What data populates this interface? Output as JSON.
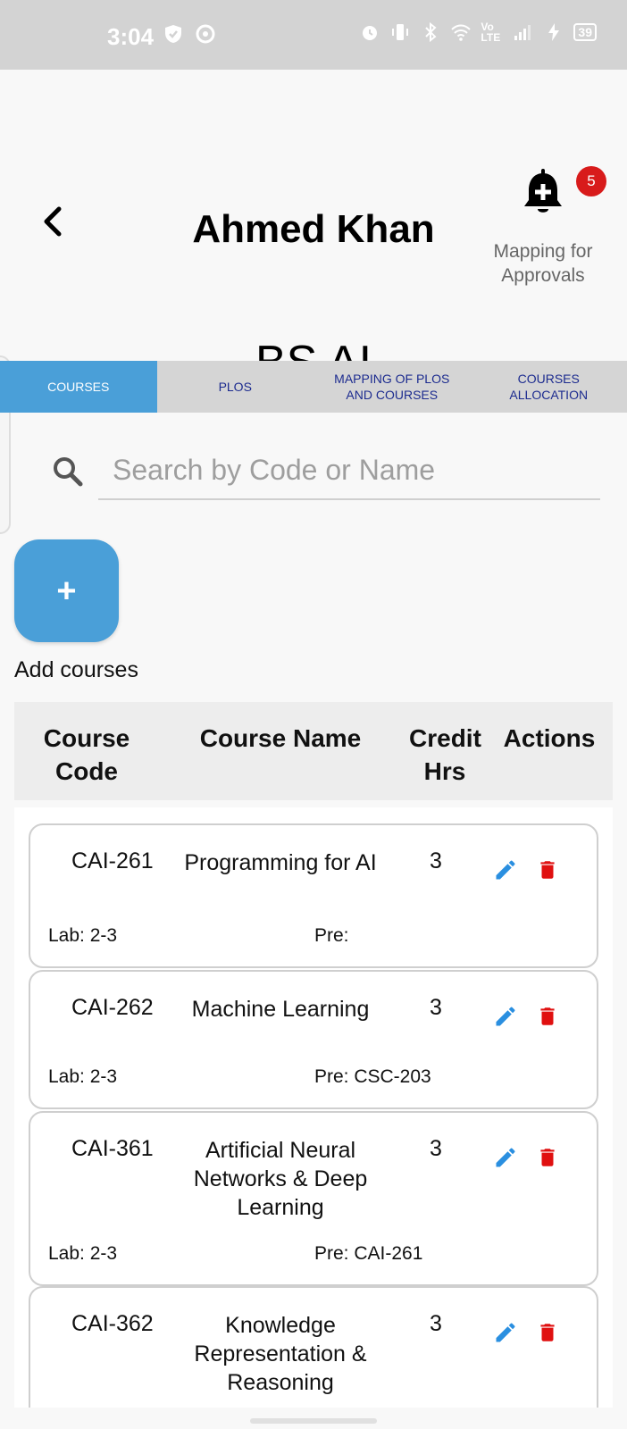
{
  "status_bar": {
    "time": "3:04",
    "network": "Vo LTE",
    "battery": "39"
  },
  "header": {
    "user_name": "Ahmed Khan",
    "notification_count": "5",
    "notification_label": "Mapping for Approvals",
    "program_name": "BS AI"
  },
  "tabs": [
    {
      "label": "COURSES",
      "active": true
    },
    {
      "label": "PLOS",
      "active": false
    },
    {
      "label": "MAPPING OF PLOS AND COURSES",
      "active": false
    },
    {
      "label": "COURSES ALLOCATION",
      "active": false
    }
  ],
  "search": {
    "placeholder": "Search by Code or Name",
    "value": ""
  },
  "add_button": {
    "icon": "+",
    "label": "Add courses"
  },
  "table": {
    "headers": {
      "code": "Course Code",
      "name": "Course Name",
      "credit": "Credit Hrs",
      "actions": "Actions"
    },
    "rows": [
      {
        "code": "CAI-261",
        "name": "Programming for AI",
        "credit": "3",
        "lab": "Lab: 2-3",
        "pre": "Pre:"
      },
      {
        "code": "CAI-262",
        "name": "Machine Learning",
        "credit": "3",
        "lab": "Lab: 2-3",
        "pre": "Pre: CSC-203"
      },
      {
        "code": "CAI-361",
        "name": "Artificial Neural Networks & Deep Learning",
        "credit": "3",
        "lab": "Lab: 2-3",
        "pre": "Pre: CAI-261"
      },
      {
        "code": "CAI-362",
        "name": "Knowledge Representation & Reasoning",
        "credit": "3",
        "lab": "",
        "pre": ""
      }
    ]
  },
  "colors": {
    "accent": "#4a9fd8",
    "tab_text": "#1c2b8f",
    "edit_icon": "#2a8fe0",
    "delete_icon": "#e01010",
    "badge": "#d81b1b"
  }
}
